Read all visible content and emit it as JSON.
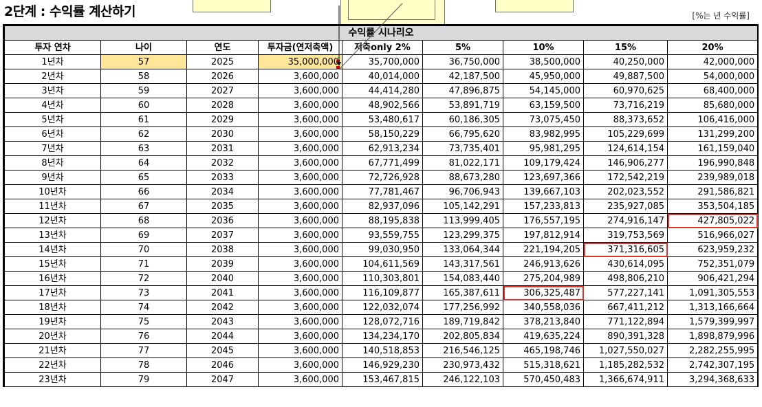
{
  "title": "2단계 : 수익률 계산하기",
  "note": "[%는 년 수익률]",
  "scenario_header": "수익률 시나리오",
  "columns": [
    "투자 연차",
    "나이",
    "연도",
    "투자금(연저축액)",
    "저축only 2%",
    "5%",
    "10%",
    "15%",
    "20%"
  ],
  "rows": [
    [
      "1년차",
      "57",
      "2025",
      "35,000,000",
      "35,700,000",
      "36,750,000",
      "38,500,000",
      "40,250,000",
      "42,000,000"
    ],
    [
      "2년차",
      "58",
      "2026",
      "3,600,000",
      "40,014,000",
      "42,187,500",
      "45,950,000",
      "49,887,500",
      "54,000,000"
    ],
    [
      "3년차",
      "59",
      "2027",
      "3,600,000",
      "44,414,280",
      "47,896,875",
      "54,145,000",
      "60,970,625",
      "68,400,000"
    ],
    [
      "4년차",
      "60",
      "2028",
      "3,600,000",
      "48,902,566",
      "53,891,719",
      "63,159,500",
      "73,716,219",
      "85,680,000"
    ],
    [
      "5년차",
      "61",
      "2029",
      "3,600,000",
      "53,480,617",
      "60,186,305",
      "73,075,450",
      "88,373,652",
      "106,416,000"
    ],
    [
      "6년차",
      "62",
      "2030",
      "3,600,000",
      "58,150,229",
      "66,795,620",
      "83,982,995",
      "105,229,699",
      "131,299,200"
    ],
    [
      "7년차",
      "63",
      "2031",
      "3,600,000",
      "62,913,234",
      "73,735,401",
      "95,981,295",
      "124,614,154",
      "161,159,040"
    ],
    [
      "8년차",
      "64",
      "2032",
      "3,600,000",
      "67,771,499",
      "81,022,171",
      "109,179,424",
      "146,906,277",
      "196,990,848"
    ],
    [
      "9년차",
      "65",
      "2033",
      "3,600,000",
      "72,726,928",
      "88,673,280",
      "123,697,366",
      "172,542,219",
      "239,989,018"
    ],
    [
      "10년차",
      "66",
      "2034",
      "3,600,000",
      "77,781,467",
      "96,706,943",
      "139,667,103",
      "202,023,552",
      "291,586,821"
    ],
    [
      "11년차",
      "67",
      "2035",
      "3,600,000",
      "82,937,096",
      "105,142,291",
      "157,233,813",
      "235,927,085",
      "353,504,185"
    ],
    [
      "12년차",
      "68",
      "2036",
      "3,600,000",
      "88,195,838",
      "113,999,405",
      "176,557,195",
      "274,916,147",
      "427,805,022"
    ],
    [
      "13년차",
      "69",
      "2037",
      "3,600,000",
      "93,559,755",
      "123,299,375",
      "197,812,914",
      "319,753,569",
      "516,966,027"
    ],
    [
      "14년차",
      "70",
      "2038",
      "3,600,000",
      "99,030,950",
      "133,064,344",
      "221,194,205",
      "371,316,605",
      "623,959,232"
    ],
    [
      "15년차",
      "71",
      "2039",
      "3,600,000",
      "104,611,569",
      "143,317,561",
      "246,913,626",
      "430,614,095",
      "752,351,079"
    ],
    [
      "16년차",
      "72",
      "2040",
      "3,600,000",
      "110,303,801",
      "154,083,440",
      "275,204,989",
      "498,806,210",
      "906,421,294"
    ],
    [
      "17년차",
      "73",
      "2041",
      "3,600,000",
      "116,109,877",
      "165,387,611",
      "306,325,487",
      "577,227,141",
      "1,091,305,553"
    ],
    [
      "18년차",
      "74",
      "2042",
      "3,600,000",
      "122,032,074",
      "177,256,992",
      "340,558,036",
      "667,411,212",
      "1,313,166,664"
    ],
    [
      "19년차",
      "75",
      "2043",
      "3,600,000",
      "128,072,716",
      "189,719,842",
      "378,213,840",
      "771,122,894",
      "1,579,399,997"
    ],
    [
      "20년차",
      "76",
      "2044",
      "3,600,000",
      "134,234,170",
      "202,805,834",
      "419,635,224",
      "890,391,328",
      "1,898,879,996"
    ],
    [
      "21년차",
      "77",
      "2045",
      "3,600,000",
      "140,518,853",
      "216,546,125",
      "465,198,746",
      "1,027,550,027",
      "2,282,255,995"
    ],
    [
      "22년차",
      "78",
      "2046",
      "3,600,000",
      "146,929,230",
      "230,973,432",
      "515,318,621",
      "1,185,282,532",
      "2,742,307,195"
    ],
    [
      "23년차",
      "79",
      "2047",
      "3,600,000",
      "153,467,815",
      "246,122,103",
      "570,450,483",
      "1,366,674,911",
      "3,294,368,633"
    ]
  ],
  "highlighted_cells": [
    [
      0,
      1
    ],
    [
      0,
      3
    ]
  ],
  "red_bordered_cells": [
    [
      11,
      8
    ],
    [
      13,
      7
    ],
    [
      16,
      6
    ]
  ],
  "colors": {
    "highlight": "#ffe699",
    "red_border": "#e0352b",
    "scenario_bg": "#d9d9d9",
    "comment_bg": "#ffffc6"
  }
}
